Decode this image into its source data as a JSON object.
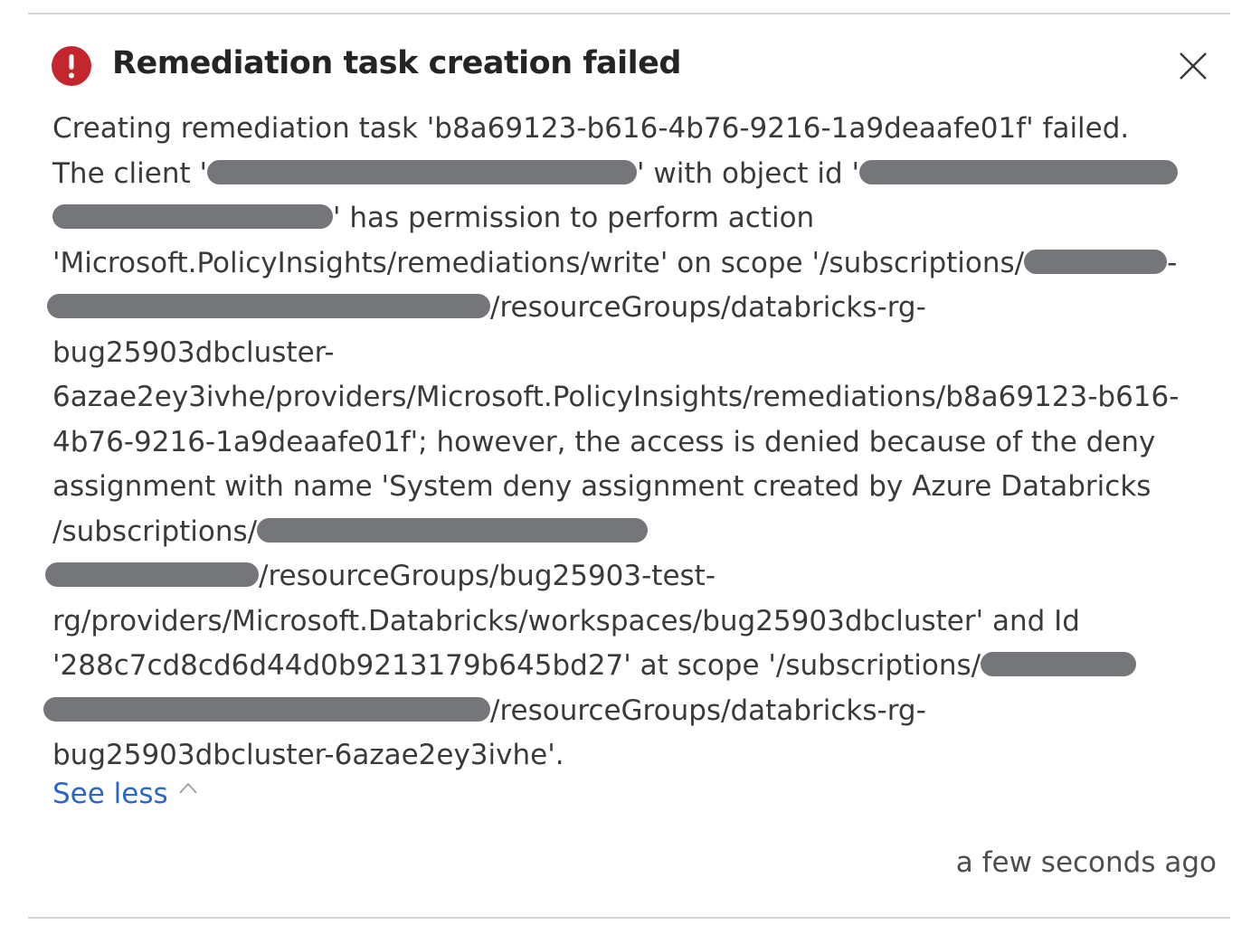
{
  "notification": {
    "title": "Remediation task creation failed",
    "icon": "error-icon",
    "icon_color": "#c4262e",
    "close_icon": "close-icon",
    "lines": {
      "l1": "Creating remediation task 'b8a69123-b616-4b76-9216-1a9deaafe01f' failed.",
      "l2a": "The client '",
      "l2b": "' with object id '",
      "l3": "' has permission to perform action",
      "l4": "'Microsoft.PolicyInsights/remediations/write' on scope '/subscriptions/",
      "l4end": "-",
      "l5": "/resourceGroups/databricks-rg-",
      "l6": "bug25903dbcluster-",
      "l7": "6azae2ey3ivhe/providers/Microsoft.PolicyInsights/remediations/b8a69123-b616-",
      "l8": "4b76-9216-1a9deaafe01f'; however, the access is denied because of the deny",
      "l9": "assignment with name 'System deny assignment created by Azure Databricks",
      "l10": "/subscriptions/",
      "l11": "/resourceGroups/bug25903-test-",
      "l12": "rg/providers/Microsoft.Databricks/workspaces/bug25903dbcluster' and Id",
      "l13": "'288c7cd8cd6d44d0b9213179b645bd27' at scope '/subscriptions/",
      "l14": "/resourceGroups/databricks-rg-",
      "l15": "bug25903dbcluster-6azae2ey3ivhe'."
    },
    "see_less_label": "See less",
    "timestamp": "a few seconds ago",
    "link_color": "#2b67c9",
    "redaction_color": "#75767a"
  }
}
